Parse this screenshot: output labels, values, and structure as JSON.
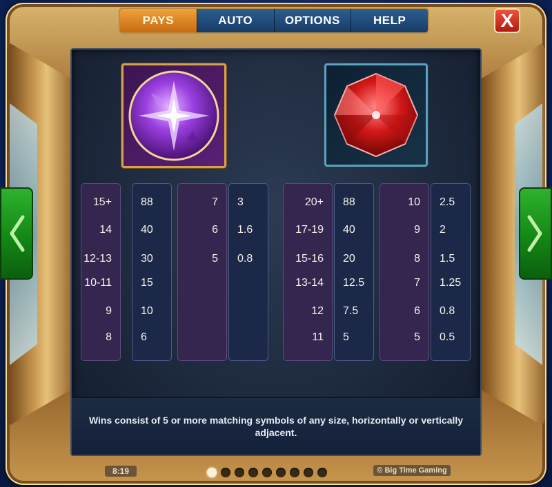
{
  "tabs": [
    {
      "label": "PAYS",
      "active": true
    },
    {
      "label": "AUTO",
      "active": false
    },
    {
      "label": "OPTIONS",
      "active": false
    },
    {
      "label": "HELP",
      "active": false
    }
  ],
  "close_label": "X",
  "symbols": [
    {
      "icon": "purple-crystal-orb-icon"
    },
    {
      "icon": "red-gem-icon"
    }
  ],
  "paytable": {
    "purple_orb": {
      "col1_counts": [
        "15+",
        "14",
        "12-13",
        "10-11",
        "9",
        "8"
      ],
      "col1_pays": [
        "88",
        "40",
        "30",
        "15",
        "10",
        "6"
      ],
      "col2_counts": [
        "7",
        "6",
        "5"
      ],
      "col2_pays": [
        "3",
        "1.6",
        "0.8"
      ]
    },
    "red_gem": {
      "col1_counts": [
        "20+",
        "17-19",
        "15-16",
        "13-14",
        "12",
        "11"
      ],
      "col1_pays": [
        "88",
        "40",
        "20",
        "12.5",
        "7.5",
        "5"
      ],
      "col2_counts": [
        "10",
        "9",
        "8",
        "7",
        "6",
        "5"
      ],
      "col2_pays": [
        "2.5",
        "2",
        "1.5",
        "1.25",
        "0.8",
        "0.5"
      ]
    }
  },
  "description": "Wins consist of 5 or more matching symbols of any size, horizontally or vertically adjacent.",
  "footer": {
    "time": "8:19",
    "brand": "© Big Time Gaming",
    "page_count": 9,
    "current_page": 1
  },
  "colors": {
    "active_tab": "#e08a25",
    "nav_green": "#1a9a1a",
    "close_red": "#d4301f"
  }
}
